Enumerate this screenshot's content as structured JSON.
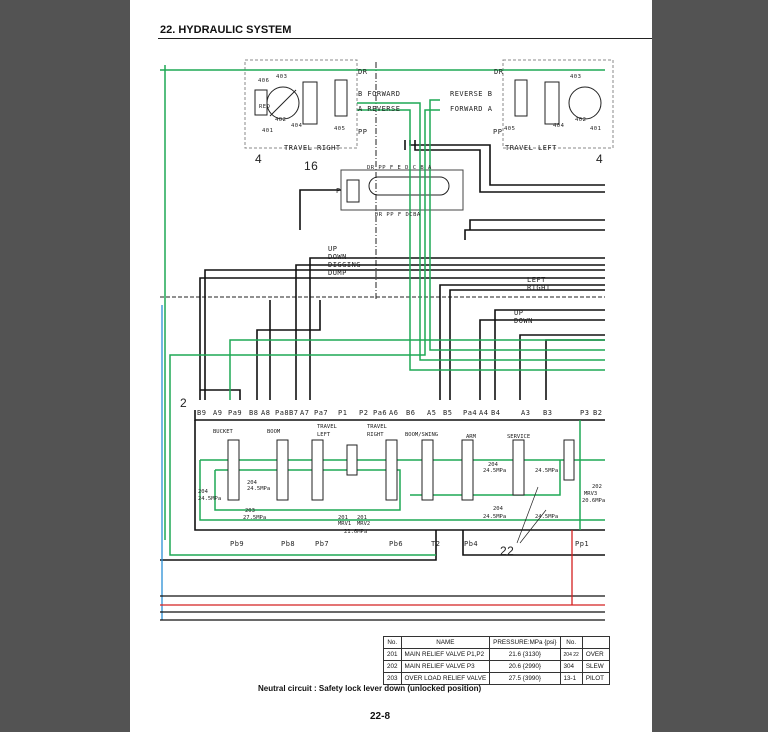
{
  "header": {
    "title": "22. HYDRAULIC SYSTEM"
  },
  "footer": {
    "page_number": "22-8"
  },
  "note": "Neutral circuit : Safety lock lever down (unlocked position)",
  "colors": {
    "pilot_line": "#1fa855",
    "main_line": "#111111",
    "drain_line": "#2a8fd6",
    "pressure_line": "#d42020",
    "background": "#535353"
  },
  "schematic": {
    "travel_right": {
      "title": "TRAVEL RIGHT",
      "ref": "4",
      "parts": [
        "406",
        "403",
        "RED",
        "402",
        "401",
        "404",
        "405"
      ],
      "ports": [
        "DR",
        "B FORWARD",
        "A REVERSE",
        "PP"
      ]
    },
    "travel_left": {
      "title": "TRAVEL LEFT",
      "ref": "4",
      "parts": [
        "403",
        "402",
        "404",
        "405",
        "401"
      ],
      "ports": [
        "DR",
        "REVERSE B",
        "FORWARD A",
        "PP"
      ]
    },
    "pilot_valve": {
      "ref": "16",
      "top_ports": "DR PP F E D C B A",
      "bottom_ports": "DR PP F DCBA",
      "port_p": "P"
    },
    "line_labels": [
      "UP",
      "DOWN",
      "DIGGING",
      "DUMP",
      "LEFT",
      "RIGHT",
      "UP",
      "DOWN"
    ],
    "control_valve": {
      "ref": "2",
      "top_ports": [
        "B9",
        "A9",
        "Pa9",
        "B8",
        "A8",
        "Pa8",
        "B7",
        "A7",
        "Pa7",
        "P1",
        "P2",
        "Pa6",
        "A6",
        "B6",
        "A5",
        "B5",
        "Pa4",
        "A4",
        "B4",
        "A3",
        "B3",
        "P3",
        "B2"
      ],
      "sections": [
        "BUCKET",
        "BOOM",
        "TRAVEL",
        "LEFT",
        "TRAVEL",
        "RIGHT",
        "BOOM/SWING",
        "ARM",
        "SERVICE"
      ],
      "bottom_ports": [
        "Pb9",
        "Pb8",
        "Pb7",
        "Pb6",
        "T2",
        "Pb4",
        "Pp1"
      ],
      "ref_22": "22",
      "valves": [
        {
          "no": "204",
          "pressure": "24.5MPa"
        },
        {
          "no": "204",
          "pressure": "24.5MPa"
        },
        {
          "no": "203",
          "pressure": "27.5MPa"
        },
        {
          "no": "201",
          "pressure": "MRV1"
        },
        {
          "no": "201",
          "pressure": "MRV2"
        },
        {
          "no": "",
          "pressure": "21.6MPa"
        },
        {
          "no": "204",
          "pressure": "24.5MPa"
        },
        {
          "no": "204",
          "pressure": "24.5MPa"
        },
        {
          "no": "",
          "pressure": "24.5MPa"
        },
        {
          "no": "",
          "pressure": "24.5MPa"
        },
        {
          "no": "202",
          "pressure": "MRV3"
        },
        {
          "no": "",
          "pressure": "20.6MPa"
        }
      ]
    }
  },
  "table": {
    "headers": [
      "No.",
      "NAME",
      "PRESSURE:MPa {psi}",
      "No.",
      ""
    ],
    "rows": [
      [
        "201",
        "MAIN RELIEF VALVE P1,P2",
        "21.6 {3130}",
        "204 22",
        "OVER"
      ],
      [
        "202",
        "MAIN RELIEF VALVE P3",
        "20.6 {2990}",
        "304",
        "SLEW"
      ],
      [
        "203",
        "OVER LOAD RELIEF VALVE",
        "27.5 {3990}",
        "13-1",
        "PILOT"
      ]
    ]
  }
}
